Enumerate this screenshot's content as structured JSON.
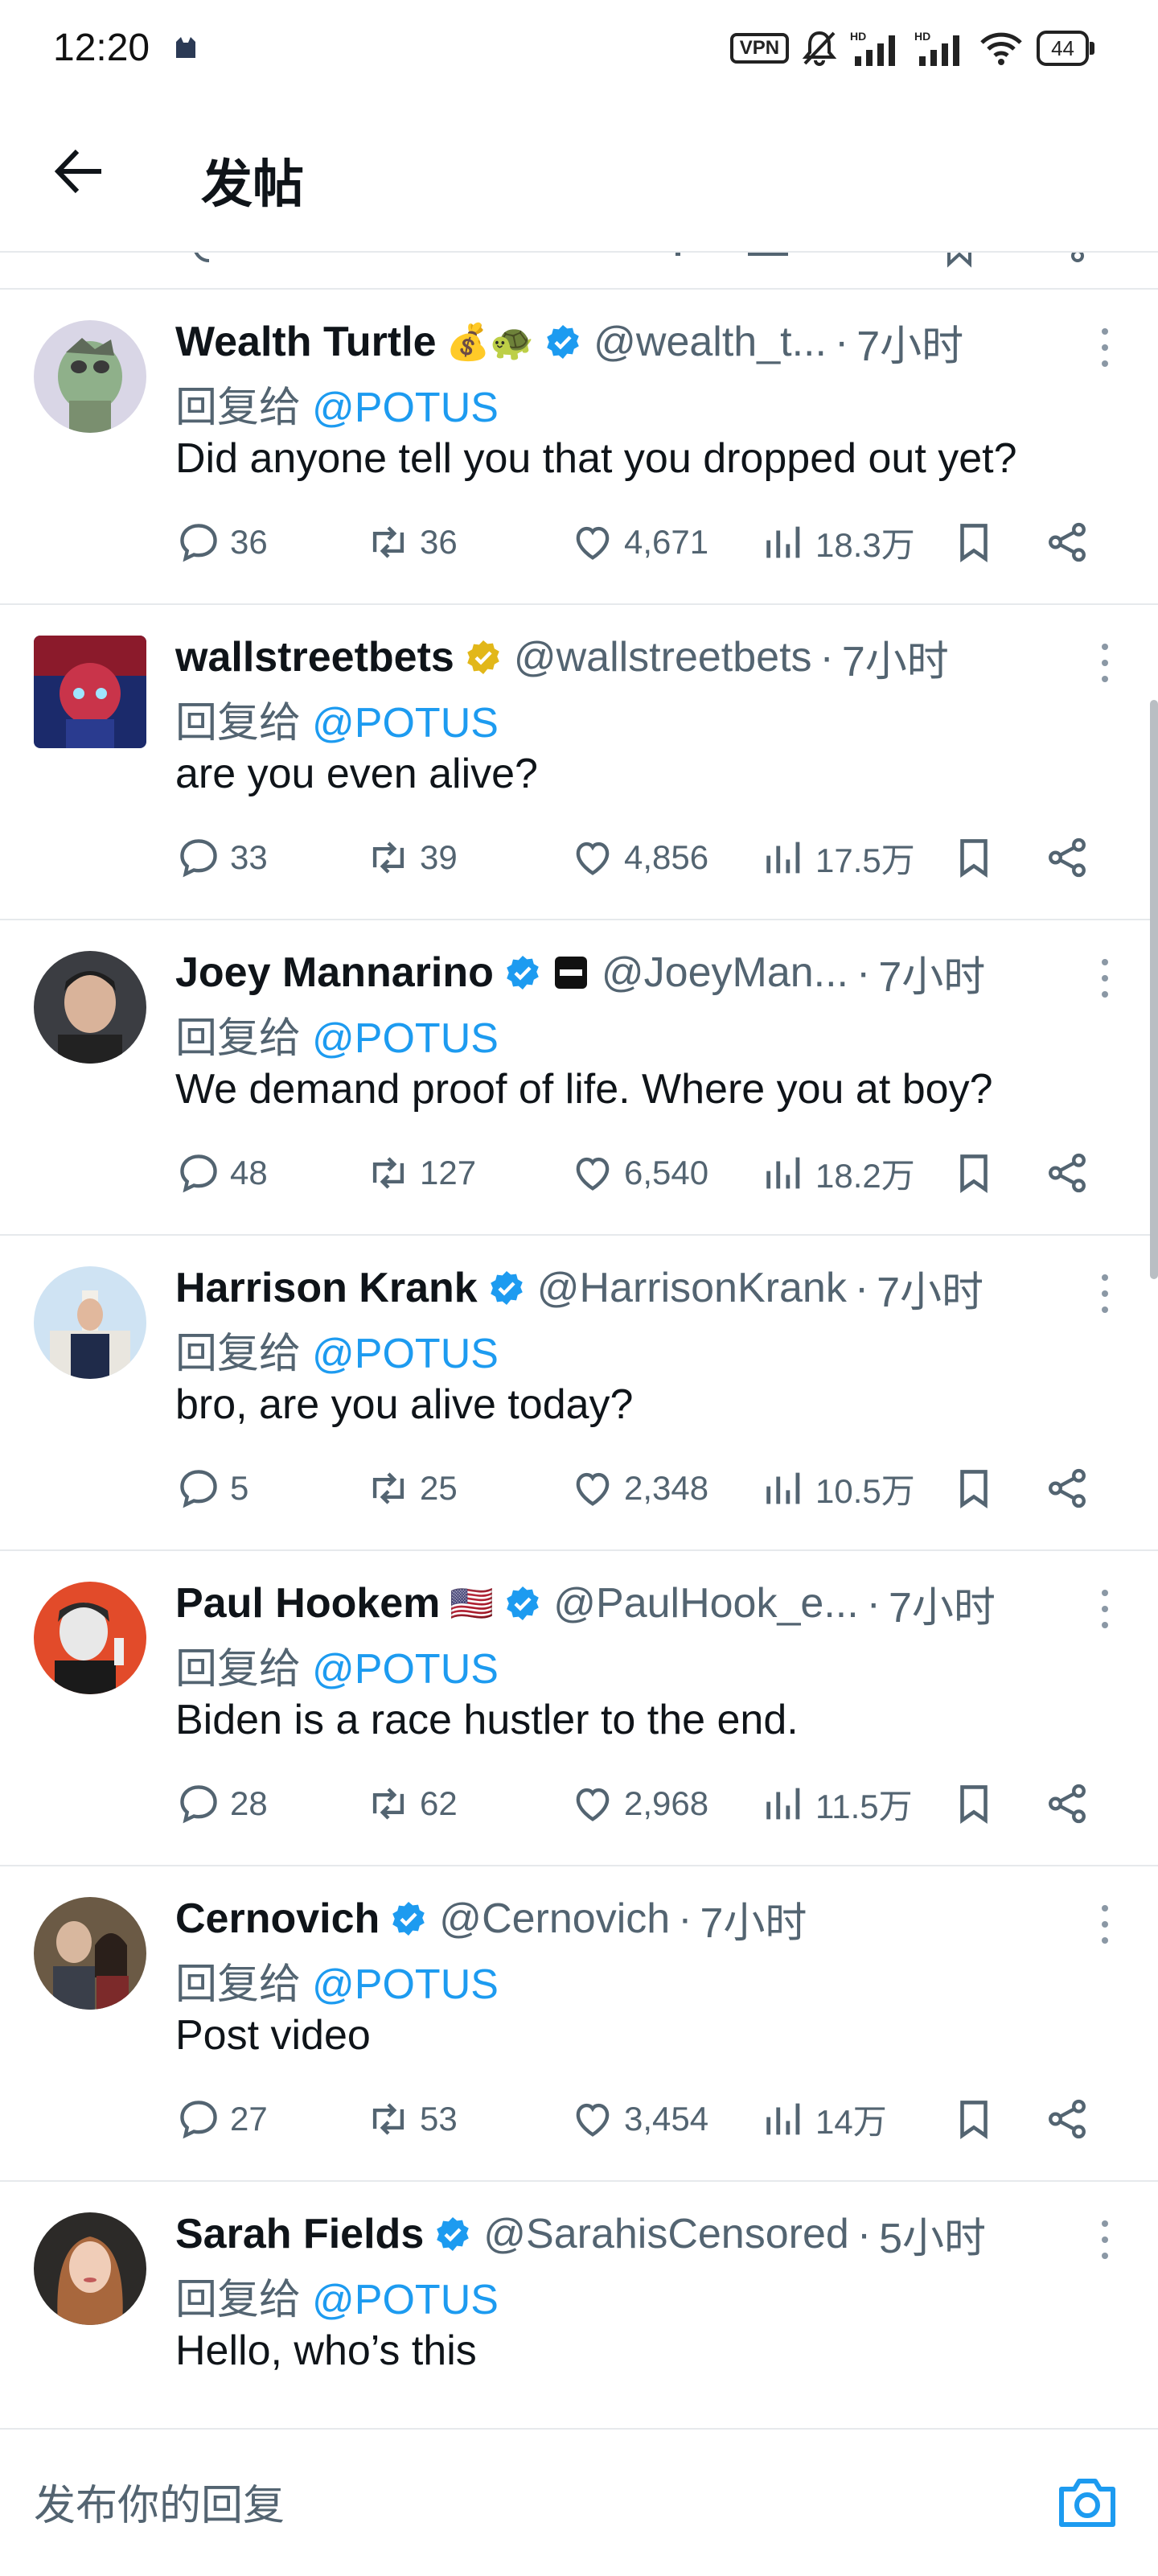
{
  "status_bar": {
    "time": "12:20",
    "vpn": "VPN",
    "battery": "44",
    "icons": [
      "cat-icon",
      "mute-icon",
      "hd-signal-icon",
      "hd-signal-icon",
      "wifi-icon"
    ]
  },
  "header": {
    "title": "发帖",
    "back_icon": "arrow-left-icon"
  },
  "colors": {
    "link": "#1d9bf0",
    "verified_blue": "#1d9bf0",
    "verified_gold": "#e2b719",
    "muted": "#536471",
    "divider": "#e6e9ec"
  },
  "tweets": [
    {
      "name": "Wealth Turtle",
      "emoji": "💰🐢",
      "badge": "blue",
      "handle": "@wealth_t...",
      "time": "7小时",
      "reply_prefix": "回复给",
      "mention": "@POTUS",
      "text": "Did anyone tell you that you dropped out yet?",
      "replies": "36",
      "retweets": "36",
      "likes": "4,671",
      "views": "18.3万"
    },
    {
      "name": "wallstreetbets",
      "emoji": "",
      "badge": "gold",
      "handle": "@wallstreetbets",
      "time": "7小时",
      "reply_prefix": "回复给",
      "mention": "@POTUS",
      "text": "are you even alive?",
      "replies": "33",
      "retweets": "39",
      "likes": "4,856",
      "views": "17.5万"
    },
    {
      "name": "Joey Mannarino",
      "emoji": "",
      "badge": "blue",
      "handle": "@JoeyMan...",
      "time": "7小时",
      "reply_prefix": "回复给",
      "mention": "@POTUS",
      "text": "We demand proof of life. Where you at boy?",
      "replies": "48",
      "retweets": "127",
      "likes": "6,540",
      "views": "18.2万"
    },
    {
      "name": "Harrison Krank",
      "emoji": "",
      "badge": "blue",
      "handle": "@HarrisonKrank",
      "time": "7小时",
      "reply_prefix": "回复给",
      "mention": "@POTUS",
      "text": "bro, are you alive today?",
      "replies": "5",
      "retweets": "25",
      "likes": "2,348",
      "views": "10.5万"
    },
    {
      "name": "Paul Hookem",
      "emoji": "🇺🇸",
      "badge": "blue",
      "handle": "@PaulHook_e...",
      "time": "7小时",
      "reply_prefix": "回复给",
      "mention": "@POTUS",
      "text": "Biden is a race hustler to the end.",
      "replies": "28",
      "retweets": "62",
      "likes": "2,968",
      "views": "11.5万"
    },
    {
      "name": "Cernovich",
      "emoji": "",
      "badge": "blue",
      "handle": "@Cernovich",
      "time": "7小时",
      "reply_prefix": "回复给",
      "mention": "@POTUS",
      "text": "Post video",
      "replies": "27",
      "retweets": "53",
      "likes": "3,454",
      "views": "14万"
    },
    {
      "name": "Sarah Fields",
      "emoji": "",
      "badge": "blue",
      "handle": "@SarahisCensored",
      "time": "5小时",
      "reply_prefix": "回复给",
      "mention": "@POTUS",
      "text": "Hello, who’s this"
    }
  ],
  "reply_bar": {
    "placeholder": "发布你的回复",
    "icon": "camera-icon"
  }
}
